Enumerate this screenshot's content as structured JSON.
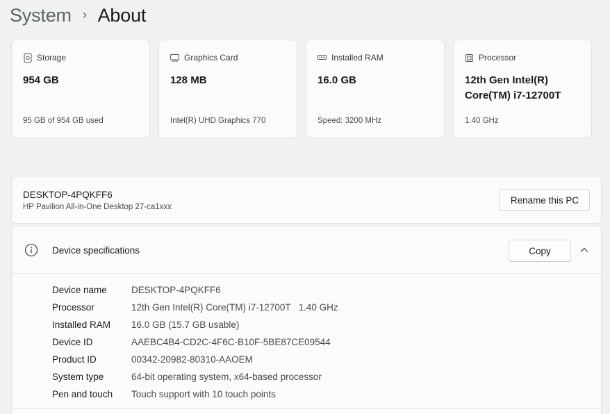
{
  "breadcrumb": {
    "parent": "System",
    "separator": "›",
    "current": "About"
  },
  "cards": [
    {
      "title": "Storage",
      "icon": "storage-icon",
      "value": "954 GB",
      "sub": "95 GB of 954 GB used"
    },
    {
      "title": "Graphics Card",
      "icon": "graphics-card-icon",
      "value": "128 MB",
      "sub": "Intel(R) UHD Graphics 770"
    },
    {
      "title": "Installed RAM",
      "icon": "ram-icon",
      "value": "16.0 GB",
      "sub": "Speed: 3200 MHz"
    },
    {
      "title": "Processor",
      "icon": "processor-icon",
      "value": "12th Gen Intel(R) Core(TM) i7-12700T",
      "sub": "1.40 GHz"
    }
  ],
  "pc": {
    "name": "DESKTOP-4PQKFF6",
    "model": "HP Pavilion All-in-One Desktop 27-ca1xxx",
    "rename_label": "Rename this PC"
  },
  "device_specs": {
    "title": "Device specifications",
    "copy_label": "Copy",
    "rows": [
      {
        "label": "Device name",
        "value": "DESKTOP-4PQKFF6"
      },
      {
        "label": "Processor",
        "value": "12th Gen Intel(R) Core(TM) i7-12700T   1.40 GHz"
      },
      {
        "label": "Installed RAM",
        "value": "16.0 GB (15.7 GB usable)"
      },
      {
        "label": "Device ID",
        "value": "AAEBC4B4-CD2C-4F6C-B10F-5BE87CE09544"
      },
      {
        "label": "Product ID",
        "value": "00342-20982-80310-AAOEM"
      },
      {
        "label": "System type",
        "value": "64-bit operating system, x64-based processor"
      },
      {
        "label": "Pen and touch",
        "value": "Touch support with 10 touch points"
      }
    ]
  }
}
